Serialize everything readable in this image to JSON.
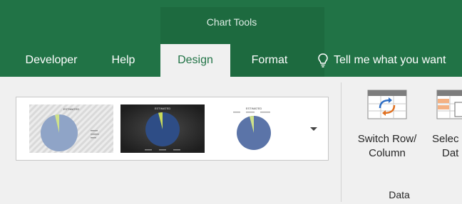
{
  "context_tab_group": {
    "label": "Chart Tools"
  },
  "tabs": [
    {
      "label": "Developer"
    },
    {
      "label": "Help"
    },
    {
      "label": "Design"
    },
    {
      "label": "Format"
    }
  ],
  "tell_me": {
    "text": "Tell me what you want"
  },
  "chart_styles": {
    "items": [
      {
        "title": "ESTIMATED"
      },
      {
        "title": "ESTIMATED"
      },
      {
        "title": "ESTIMATED"
      }
    ]
  },
  "data_group": {
    "label": "Data",
    "switch_row_column": {
      "line1": "Switch Row/",
      "line2": "Column"
    },
    "select_data": {
      "line1": "Selec",
      "line2": "Dat"
    }
  },
  "colors": {
    "ribbon_green": "#217346",
    "context_green": "#1d6a3f",
    "ribbon_background": "#f0f0f0"
  }
}
